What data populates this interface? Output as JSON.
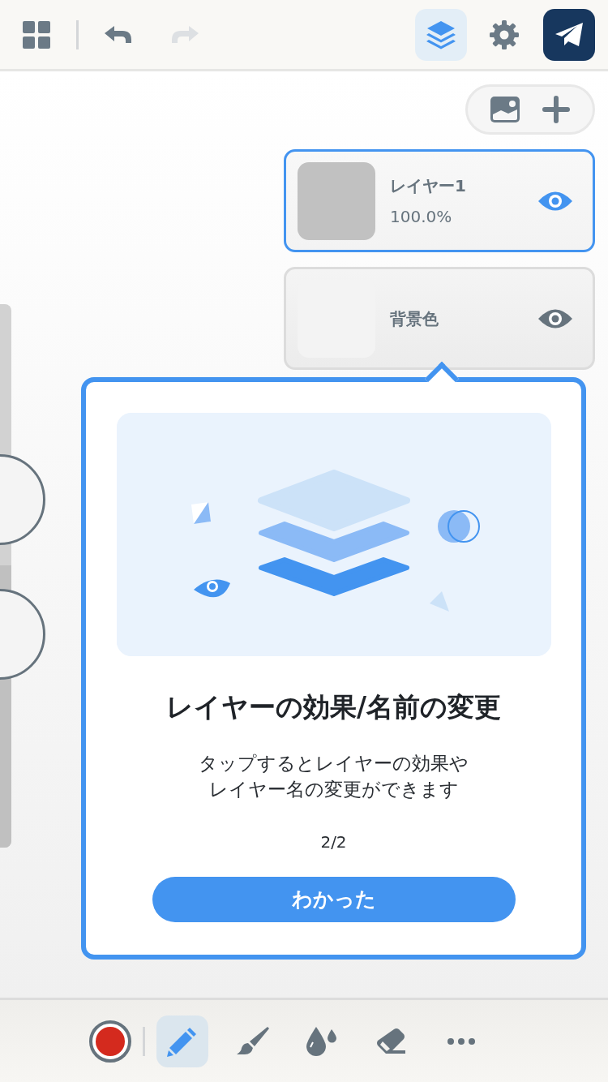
{
  "size_slider": {
    "level": 0.52
  },
  "toolbar": {
    "undo_disabled": false,
    "redo_disabled": true,
    "layers_selected": true
  },
  "layers": [
    {
      "name": "レイヤー1",
      "opacity": "100.0%",
      "selected": true,
      "visible": true
    },
    {
      "name": "背景色",
      "selected": false,
      "visible": true
    }
  ],
  "tip": {
    "title": "レイヤーの効果/名前の変更",
    "body_lines": [
      "タップするとレイヤーの効果や",
      "レイヤー名の変更ができます"
    ],
    "page": "2/2",
    "button": "わかった"
  },
  "tools": [
    {
      "kind": "color",
      "color": "#d42a1e"
    },
    {
      "kind": "pencil",
      "selected": true
    },
    {
      "kind": "brush",
      "selected": false
    },
    {
      "kind": "drops",
      "selected": false
    },
    {
      "kind": "eraser",
      "selected": false
    },
    {
      "kind": "more",
      "selected": false
    }
  ]
}
